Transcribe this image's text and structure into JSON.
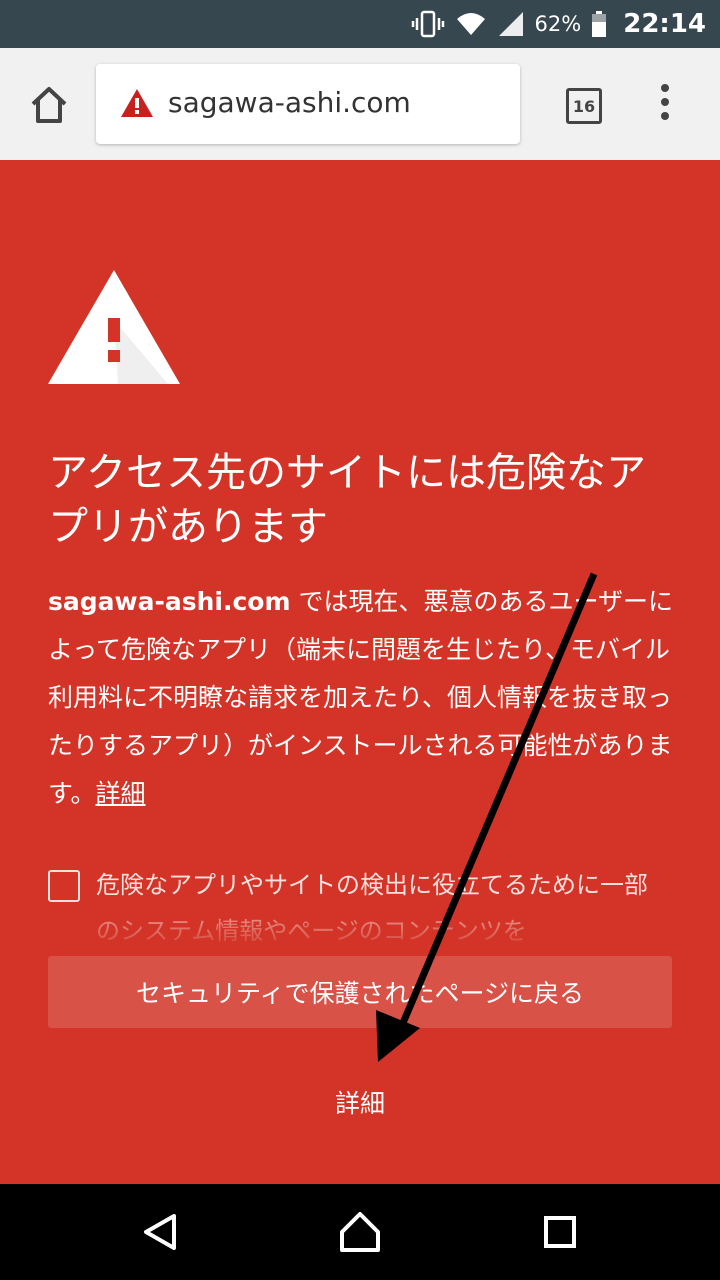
{
  "status_bar": {
    "battery": "62%",
    "time": "22:14"
  },
  "toolbar": {
    "url": "sagawa-ashi.com",
    "tab_count": "16"
  },
  "interstitial": {
    "heading": "アクセス先のサイトには危険なアプリがあります",
    "body_domain": "sagawa-ashi.com",
    "body_text": " では現在、悪意のあるユーザーによって危険なアプリ（端末に問題を生じたり、モバイル利用料に不明瞭な請求を加えたり、個人情報を抜き取ったりするアプリ）がインストールされる可能性があります。",
    "details_link": "詳細",
    "checkbox_label": "危険なアプリやサイトの検出に役立てるために一部のシステム情報やページのコンテンツを",
    "back_button": "セキュリティで保護されたページに戻る",
    "details_button": "詳細"
  },
  "colors": {
    "background": "#d33427",
    "toolbar": "#f1f1f1",
    "status_bar": "#37474f"
  },
  "icons": [
    "home-icon",
    "warning-icon",
    "tab-switcher-icon",
    "more-menu-icon",
    "back-icon",
    "home-nav-icon",
    "recents-icon"
  ]
}
